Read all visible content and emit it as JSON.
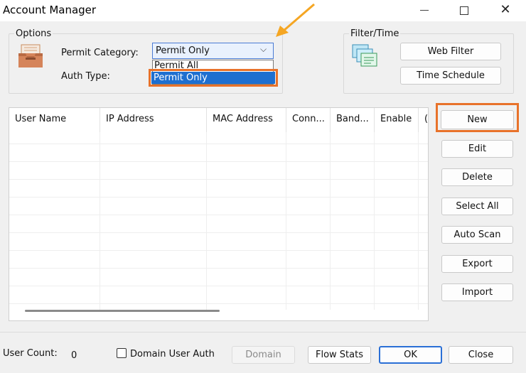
{
  "window": {
    "title": "Account Manager"
  },
  "options": {
    "group_label": "Options",
    "permit_category_label": "Permit Category:",
    "permit_category_value": "Permit Only",
    "auth_type_label": "Auth Type:",
    "dropdown_options": [
      "Permit All",
      "Permit Only"
    ]
  },
  "filter_time": {
    "group_label": "Filter/Time",
    "web_filter_button": "Web Filter",
    "time_schedule_button": "Time Schedule"
  },
  "table": {
    "columns": [
      "User Name",
      "IP Address",
      "MAC Address",
      "Conn...",
      "Band...",
      "Enable",
      "("
    ]
  },
  "side_buttons": {
    "new": "New",
    "edit": "Edit",
    "delete": "Delete",
    "select_all": "Select All",
    "auto_scan": "Auto Scan",
    "export": "Export",
    "import": "Import"
  },
  "footer": {
    "user_count_label": "User Count:",
    "user_count_value": "0",
    "domain_user_auth_label": "Domain User Auth",
    "domain_button": "Domain",
    "flow_stats_button": "Flow Stats",
    "ok_button": "OK",
    "close_button": "Close"
  },
  "colors": {
    "highlight": "#e8722a",
    "arrow": "#f5a623",
    "selection": "#1e6fd0"
  }
}
